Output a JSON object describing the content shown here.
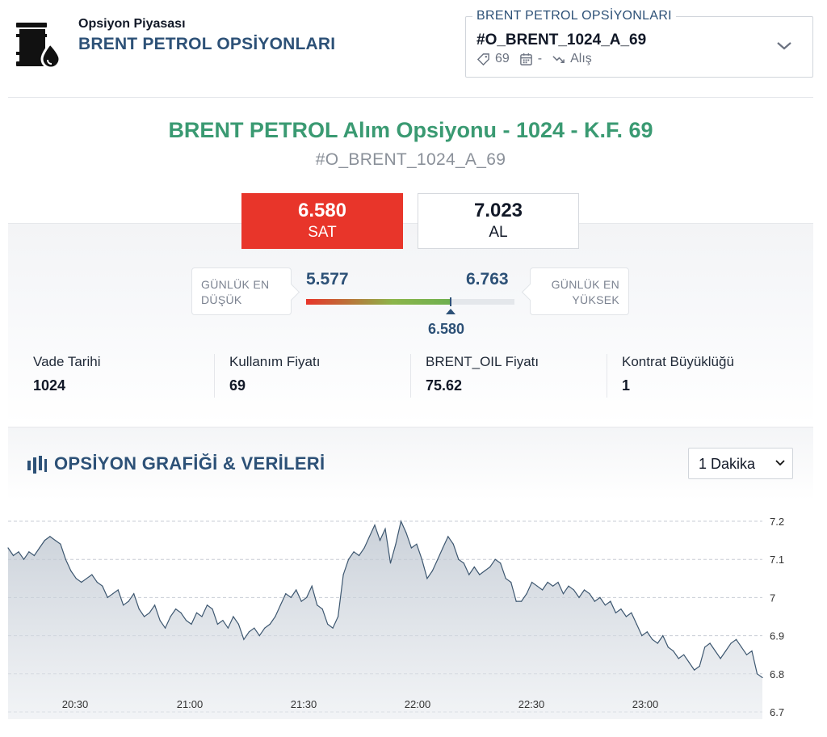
{
  "header": {
    "subtitle": "Opsiyon Piyasası",
    "title": "BRENT PETROL OPSİYONLARI",
    "logo_icon": "oil-barrel-drop-icon"
  },
  "selector": {
    "legend": "BRENT PETROL OPSİYONLARI",
    "value": "#O_BRENT_1024_A_69",
    "strike": "69",
    "date": "-",
    "side": "Alış",
    "icons": [
      "tag-icon",
      "calendar-icon",
      "trend-icon",
      "chevron-down-icon"
    ]
  },
  "instrument": {
    "title": "BRENT PETROL Alım Opsiyonu - 1024 - K.F. 69",
    "code": "#O_BRENT_1024_A_69"
  },
  "quote": {
    "sell_price": "6.580",
    "sell_label": "SAT",
    "buy_price": "7.023",
    "buy_label": "AL",
    "sell_color": "#e8352a"
  },
  "daily_range": {
    "low_label_1": "GÜNLÜK EN",
    "low_label_2": "DÜŞÜK",
    "high_label_1": "GÜNLÜK EN",
    "high_label_2": "YÜKSEK",
    "low": "5.577",
    "high": "6.763",
    "current": "6.580",
    "current_value": 6.58,
    "low_value": 5.577,
    "high_value": 6.763,
    "scale_max": 7.023
  },
  "stats": [
    {
      "label": "Vade Tarihi",
      "value": "1024"
    },
    {
      "label": "Kullanım Fiyatı",
      "value": "69"
    },
    {
      "label": "BRENT_OIL Fiyatı",
      "value": "75.62"
    },
    {
      "label": "Kontrat Büyüklüğü",
      "value": "1"
    }
  ],
  "chart_section": {
    "title": "OPSİYON GRAFİĞİ & VERİLERİ",
    "icon": "bar-chart-icon",
    "interval": "1 Dakika"
  },
  "chart_data": {
    "type": "area",
    "title": "",
    "xlabel": "",
    "ylabel": "",
    "x_ticks": [
      "20:30",
      "21:00",
      "21:30",
      "22:00",
      "22:30",
      "23:00"
    ],
    "y_ticks": [
      "7.2",
      "7.1",
      "7",
      "6.9",
      "6.8",
      "6.7"
    ],
    "ylim": [
      6.7,
      7.22
    ],
    "x_range": [
      "20:12",
      "23:30"
    ],
    "grid": true,
    "series": [
      {
        "values": [
          7.13,
          7.11,
          7.12,
          7.1,
          7.12,
          7.11,
          7.13,
          7.15,
          7.16,
          7.15,
          7.14,
          7.1,
          7.07,
          7.05,
          7.04,
          7.05,
          7.06,
          7.04,
          7.03,
          7.0,
          7.01,
          7.02,
          6.98,
          6.99,
          7.01,
          6.97,
          6.95,
          6.96,
          6.98,
          6.94,
          6.92,
          6.95,
          6.97,
          6.96,
          6.94,
          6.93,
          6.96,
          6.95,
          6.98,
          6.97,
          6.93,
          6.94,
          6.92,
          6.95,
          6.93,
          6.89,
          6.91,
          6.92,
          6.9,
          6.92,
          6.93,
          6.95,
          6.98,
          7.01,
          7.0,
          7.02,
          6.99,
          7.0,
          7.03,
          6.98,
          6.97,
          6.93,
          6.92,
          6.95,
          7.06,
          7.1,
          7.12,
          7.11,
          7.13,
          7.16,
          7.19,
          7.15,
          7.18,
          7.09,
          7.14,
          7.2,
          7.17,
          7.13,
          7.14,
          7.1,
          7.05,
          7.07,
          7.1,
          7.13,
          7.16,
          7.14,
          7.1,
          7.09,
          7.06,
          7.08,
          7.06,
          7.07,
          7.08,
          7.1,
          7.09,
          7.05,
          7.04,
          6.99,
          6.99,
          7.01,
          7.04,
          7.03,
          7.02,
          7.04,
          7.03,
          7.04,
          7.01,
          7.03,
          7.02,
          7.0,
          7.02,
          7.01,
          6.99,
          7.0,
          6.98,
          6.99,
          6.96,
          6.97,
          6.95,
          6.96,
          6.93,
          6.9,
          6.91,
          6.89,
          6.88,
          6.9,
          6.87,
          6.86,
          6.84,
          6.85,
          6.83,
          6.81,
          6.82,
          6.87,
          6.88,
          6.86,
          6.84,
          6.86,
          6.88,
          6.89,
          6.87,
          6.85,
          6.86,
          6.8,
          6.79
        ]
      }
    ]
  },
  "colors": {
    "accent_blue": "#2d5177",
    "title_green": "#3a9a72",
    "sell_red": "#e8352a",
    "line": "#3d5770"
  }
}
